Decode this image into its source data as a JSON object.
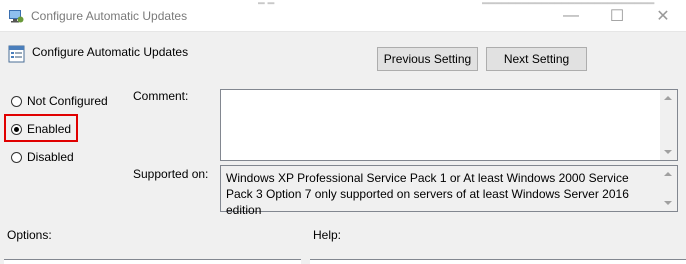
{
  "window": {
    "title": "Configure Automatic Updates",
    "controls": {
      "minimize": "—",
      "maximize": "☐",
      "close": "✕"
    }
  },
  "header": {
    "policy_name": "Configure Automatic Updates",
    "previous_label": "Previous Setting",
    "next_label": "Next Setting"
  },
  "state": {
    "options": [
      {
        "label": "Not Configured",
        "checked": false
      },
      {
        "label": "Enabled",
        "checked": true
      },
      {
        "label": "Disabled",
        "checked": false
      }
    ]
  },
  "comment": {
    "label": "Comment:",
    "value": ""
  },
  "supported": {
    "label": "Supported on:",
    "text": "Windows XP Professional Service Pack 1 or At least Windows 2000 Service Pack 3 Option 7 only supported on servers of at least Windows Server 2016 edition"
  },
  "panes": {
    "options_label": "Options:",
    "help_label": "Help:"
  },
  "colors": {
    "highlight": "#e00000"
  }
}
